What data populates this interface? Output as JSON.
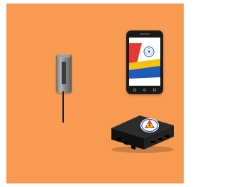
{
  "colors": {
    "background": "#f89a52",
    "sensor_body": "#9a9a9a",
    "phone_body": "#1a1a1a",
    "app_red": "#e53935",
    "app_yellow": "#f4c20d",
    "app_blue": "#1e5bb8",
    "gateway_body": "#1c1c1c"
  },
  "illustration": {
    "sensor": {
      "icon": "wireless-sensor-icon"
    },
    "phone": {
      "icon": "smartphone-icon",
      "screen_icon": "app-logo-icon"
    },
    "gateway": {
      "icon": "gateway-box-icon",
      "badge_icon": "logo-badge-icon"
    }
  }
}
